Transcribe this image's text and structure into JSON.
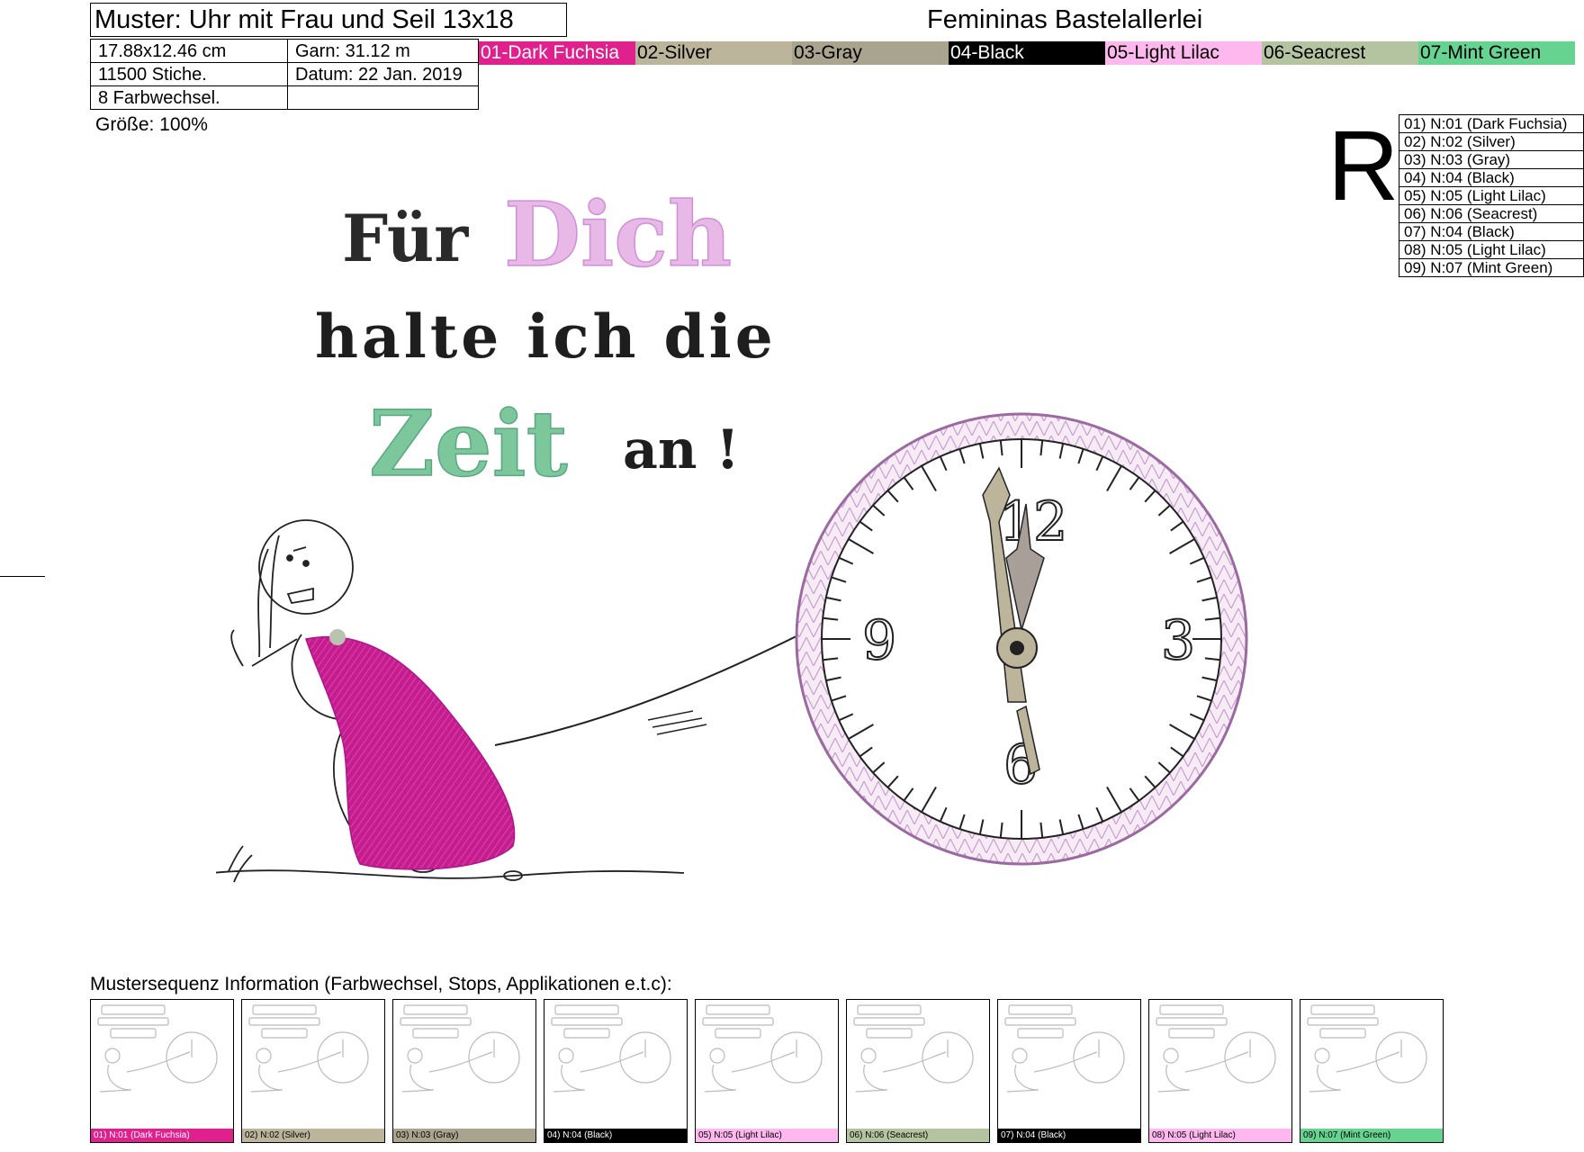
{
  "header": {
    "title": "Muster: Uhr mit Frau und Seil 13x18",
    "size": "17.88x12.46 cm",
    "garn": "Garn: 31.12 m",
    "stiche": "11500 Stiche.",
    "datum": "Datum: 22 Jan. 2019",
    "farbwechsel": "8 Farbwechsel.",
    "groesse": "Größe: 100%",
    "brand": "Femininas Bastelallerlei"
  },
  "colors": [
    {
      "label": "01-Dark Fuchsia",
      "bg": "#e0208c",
      "fg": "#ffffff"
    },
    {
      "label": "02-Silver",
      "bg": "#bdb49c",
      "fg": "#000000"
    },
    {
      "label": "03-Gray",
      "bg": "#a8a48e",
      "fg": "#000000"
    },
    {
      "label": "04-Black",
      "bg": "#000000",
      "fg": "#ffffff"
    },
    {
      "label": "05-Light Lilac",
      "bg": "#ffb8ee",
      "fg": "#000000"
    },
    {
      "label": "06-Seacrest",
      "bg": "#b4c4a0",
      "fg": "#000000"
    },
    {
      "label": "07-Mint Green",
      "bg": "#66d490",
      "fg": "#000000"
    }
  ],
  "r_letter": "R",
  "legend": [
    "01) N:01 (Dark Fuchsia)",
    "02) N:02 (Silver)",
    "03) N:03 (Gray)",
    "04) N:04 (Black)",
    "05) N:05 (Light Lilac)",
    "06) N:06 (Seacrest)",
    "07) N:04 (Black)",
    "08) N:05 (Light Lilac)",
    "09) N:07 (Mint Green)"
  ],
  "design": {
    "line1_a": "Für",
    "line1_b": "Dich",
    "line2": "halte ich die",
    "line3_a": "Zeit",
    "line3_b": "an !",
    "clock_12": "12",
    "clock_3": "3",
    "clock_6": "6",
    "clock_9": "9"
  },
  "sequence": {
    "title": "Mustersequenz Information (Farbwechsel, Stops, Applikationen e.t.c):",
    "steps": [
      {
        "caption": "01) N:01 (Dark Fuchsia)",
        "bg": "#e0208c",
        "fg": "#ffffff"
      },
      {
        "caption": "02) N:02 (Silver)",
        "bg": "#bdb49c",
        "fg": "#000000"
      },
      {
        "caption": "03) N:03 (Gray)",
        "bg": "#a8a48e",
        "fg": "#000000"
      },
      {
        "caption": "04) N:04 (Black)",
        "bg": "#000000",
        "fg": "#ffffff"
      },
      {
        "caption": "05) N:05 (Light Lilac)",
        "bg": "#ffb8ee",
        "fg": "#000000"
      },
      {
        "caption": "06) N:06 (Seacrest)",
        "bg": "#b4c4a0",
        "fg": "#000000"
      },
      {
        "caption": "07) N:04 (Black)",
        "bg": "#000000",
        "fg": "#ffffff"
      },
      {
        "caption": "08) N:05 (Light Lilac)",
        "bg": "#ffb8ee",
        "fg": "#000000"
      },
      {
        "caption": "09) N:07 (Mint Green)",
        "bg": "#66d490",
        "fg": "#000000"
      }
    ]
  }
}
